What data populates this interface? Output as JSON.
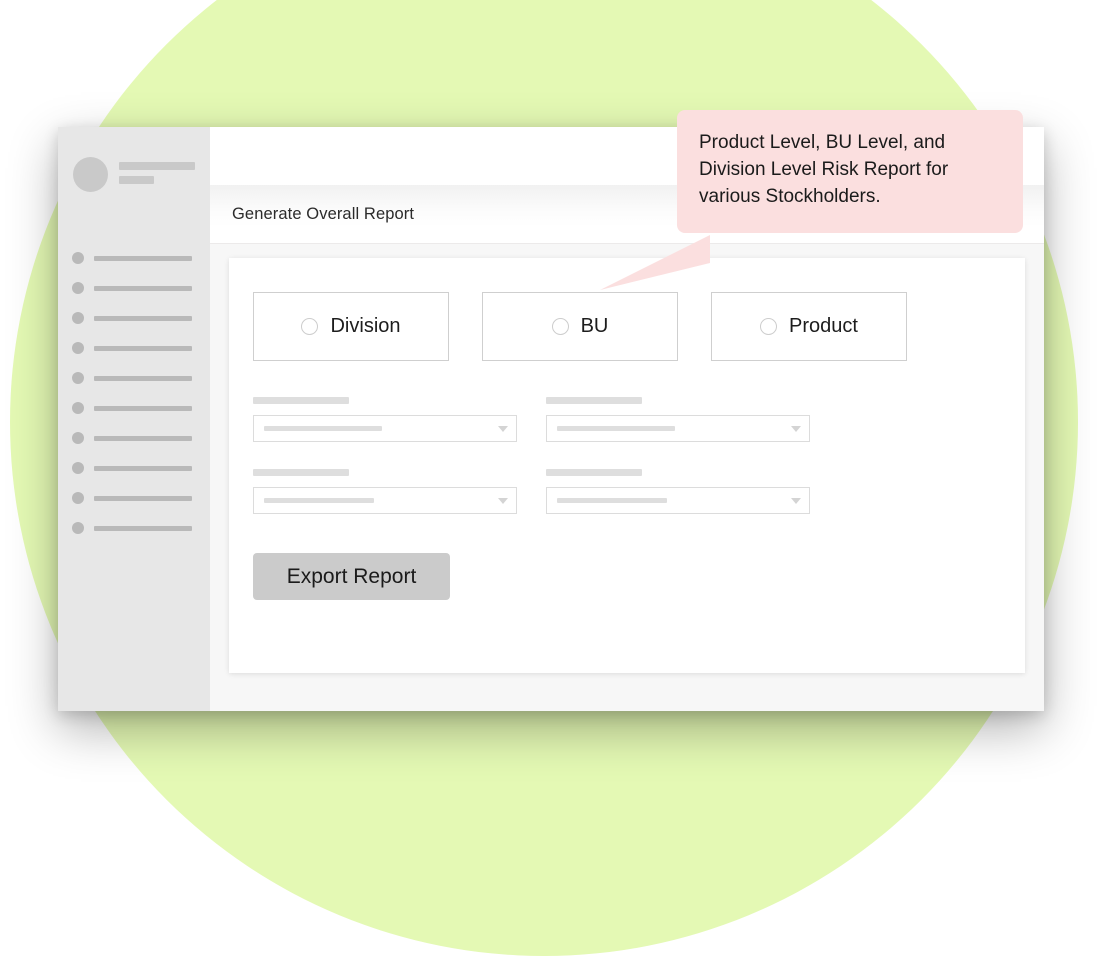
{
  "background": {
    "circle_color": "#e4f9b4",
    "name": "decorative-green-circle"
  },
  "window": {
    "sidebar": {
      "profile": {
        "avatar": "user-avatar-placeholder",
        "line_count": 2
      },
      "nav_item_count": 10,
      "items": [
        {
          "id": "nav-1"
        },
        {
          "id": "nav-2"
        },
        {
          "id": "nav-3"
        },
        {
          "id": "nav-4"
        },
        {
          "id": "nav-5"
        },
        {
          "id": "nav-6"
        },
        {
          "id": "nav-7"
        },
        {
          "id": "nav-8"
        },
        {
          "id": "nav-9"
        },
        {
          "id": "nav-10"
        }
      ]
    },
    "header": {
      "title": "Generate Overall Report"
    },
    "form": {
      "report_level_options": [
        {
          "label": "Division",
          "selected": false
        },
        {
          "label": "BU",
          "selected": false
        },
        {
          "label": "Product",
          "selected": false
        }
      ],
      "fields": [
        {
          "label_width": 96,
          "value_width": 118
        },
        {
          "label_width": 96,
          "value_width": 118
        },
        {
          "label_width": 96,
          "value_width": 110
        },
        {
          "label_width": 96,
          "value_width": 110
        }
      ],
      "export_button_label": "Export Report"
    }
  },
  "callout": {
    "text": "Product Level, BU Level, and Division Level Risk Report for various Stockholders.",
    "background_color": "#fbdfdf",
    "text_color": "#1b1b1b"
  }
}
